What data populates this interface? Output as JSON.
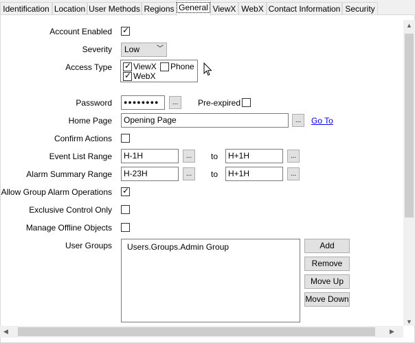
{
  "tabs": [
    {
      "label": "Identification",
      "active": false
    },
    {
      "label": "Location",
      "active": false
    },
    {
      "label": "User Methods",
      "active": false
    },
    {
      "label": "Regions",
      "active": false
    },
    {
      "label": "General",
      "active": true
    },
    {
      "label": "ViewX",
      "active": false
    },
    {
      "label": "WebX",
      "active": false
    },
    {
      "label": "Contact Information",
      "active": false
    },
    {
      "label": "Security",
      "active": false
    }
  ],
  "form": {
    "account_enabled": {
      "label": "Account Enabled",
      "checked": true
    },
    "severity": {
      "label": "Severity",
      "value": "Low"
    },
    "access_type": {
      "label": "Access Type",
      "viewx": {
        "label": "ViewX",
        "checked": true
      },
      "phone": {
        "label": "Phone",
        "checked": false
      },
      "webx": {
        "label": "WebX",
        "checked": true
      }
    },
    "password": {
      "label": "Password",
      "value": "●●●●●●●●",
      "button": "..."
    },
    "pre_expired": {
      "label": "Pre-expired",
      "checked": false
    },
    "home_page": {
      "label": "Home Page",
      "value": "Opening Page",
      "button": "...",
      "link": "Go To"
    },
    "confirm_actions": {
      "label": "Confirm Actions",
      "checked": false
    },
    "event_list_range": {
      "label": "Event List Range",
      "from": "H-1H",
      "to_label": "to",
      "to": "H+1H",
      "button": "..."
    },
    "alarm_summary_range": {
      "label": "Alarm Summary Range",
      "from": "H-23H",
      "to_label": "to",
      "to": "H+1H",
      "button": "..."
    },
    "allow_group_alarm_operations": {
      "label": "Allow Group Alarm Operations",
      "checked": true
    },
    "exclusive_control_only": {
      "label": "Exclusive Control Only",
      "checked": false
    },
    "manage_offline_objects": {
      "label": "Manage Offline Objects",
      "checked": false
    },
    "user_groups": {
      "label": "User Groups",
      "items": [
        "Users.Groups.Admin Group"
      ],
      "buttons": {
        "add": "Add",
        "remove": "Remove",
        "move_up": "Move Up",
        "move_down": "Move Down"
      }
    }
  },
  "icons": {
    "check": "✓",
    "chevron_down": "﹀",
    "arrow_up": "▲",
    "arrow_down": "▼",
    "arrow_left": "◀",
    "arrow_right": "▶",
    "cursor": "mouse-pointer-icon"
  }
}
